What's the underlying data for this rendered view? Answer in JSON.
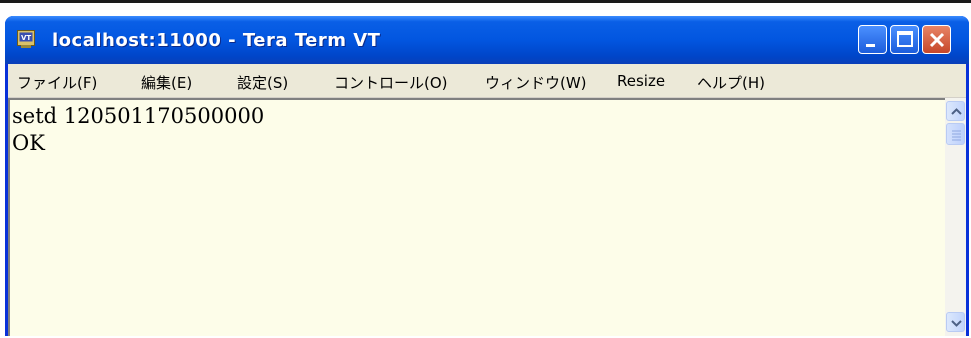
{
  "window": {
    "title": "localhost:11000 - Tera Term VT"
  },
  "menu": {
    "items": [
      "ファイル(F)",
      "編集(E)",
      "設定(S)",
      "コントロール(O)",
      "ウィンドウ(W)",
      "Resize",
      "ヘルプ(H)"
    ]
  },
  "terminal": {
    "lines": [
      "setd 120501170500000",
      "OK"
    ]
  },
  "colors": {
    "titlebar": "#0256e0",
    "terminal_background": "#fdfde9",
    "menubar": "#ece9d8",
    "close_button": "#c6472a"
  },
  "icons": {
    "app": "tera-term-app-icon",
    "minimize": "minimize-icon",
    "maximize": "maximize-icon",
    "close": "close-icon",
    "scroll_up": "chevron-up-icon",
    "scroll_down": "chevron-down-icon"
  }
}
